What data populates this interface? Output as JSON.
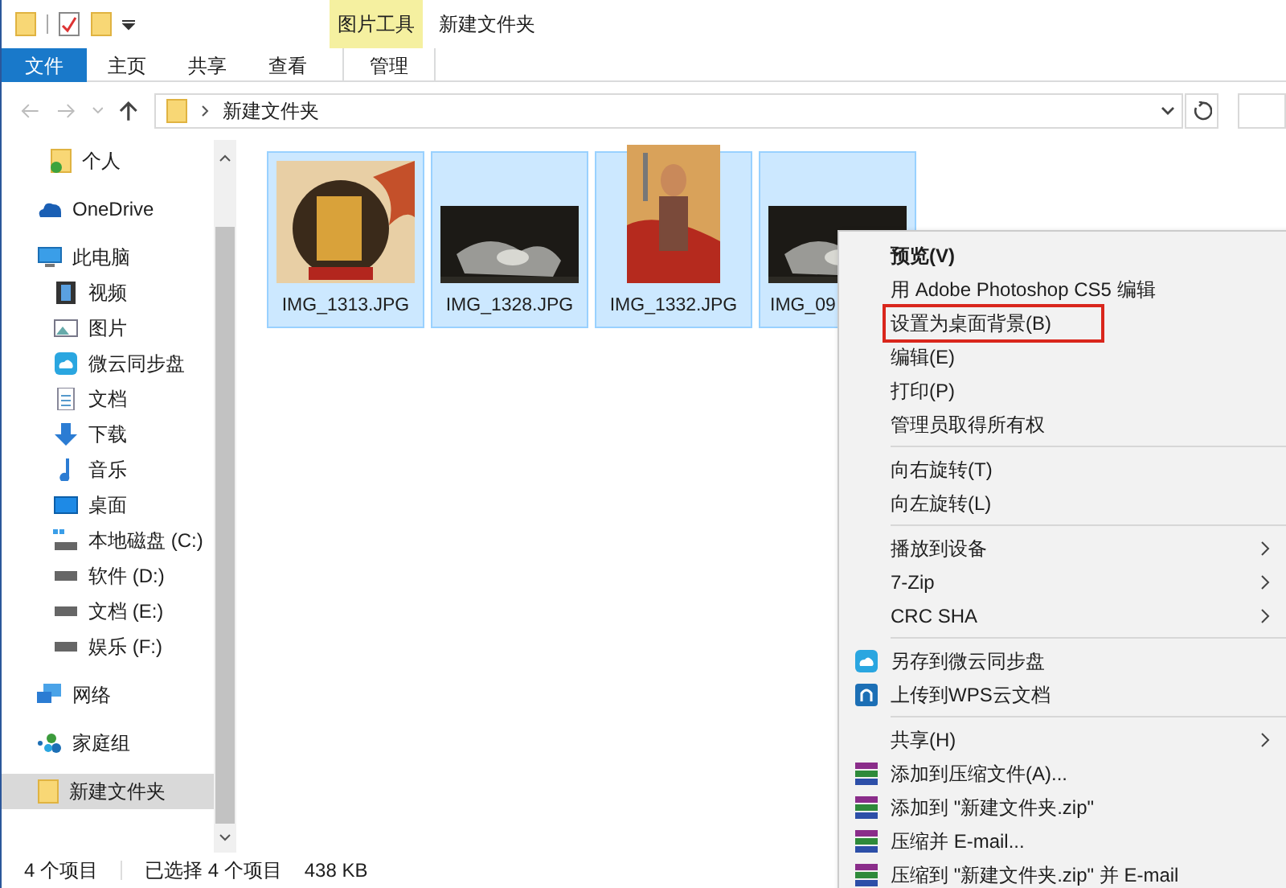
{
  "window": {
    "title": "新建文件夹"
  },
  "ribbon": {
    "context_group": "图片工具",
    "tabs": [
      {
        "label": "文件",
        "kind": "file",
        "selected": false
      },
      {
        "label": "主页",
        "kind": "tab",
        "selected": false
      },
      {
        "label": "共享",
        "kind": "tab",
        "selected": false
      },
      {
        "label": "查看",
        "kind": "tab",
        "selected": false
      },
      {
        "label": "管理",
        "kind": "context",
        "selected": false
      }
    ]
  },
  "address_bar": {
    "path": "新建文件夹"
  },
  "nav": {
    "quick_access_children": [
      {
        "label": "个人",
        "kind": "folder-check",
        "selected": false
      }
    ],
    "items": [
      {
        "label": "OneDrive",
        "kind": "cloud",
        "selected": false
      },
      {
        "label": "此电脑",
        "kind": "pc",
        "selected": false,
        "children": [
          {
            "label": "视频",
            "kind": "video",
            "selected": false
          },
          {
            "label": "图片",
            "kind": "picture",
            "selected": false
          },
          {
            "label": "微云同步盘",
            "kind": "weiyun",
            "selected": false
          },
          {
            "label": "文档",
            "kind": "document",
            "selected": false
          },
          {
            "label": "下载",
            "kind": "download",
            "selected": false
          },
          {
            "label": "音乐",
            "kind": "music",
            "selected": false
          },
          {
            "label": "桌面",
            "kind": "desktop",
            "selected": false
          },
          {
            "label": "本地磁盘 (C:)",
            "kind": "system-drive",
            "selected": false
          },
          {
            "label": "软件 (D:)",
            "kind": "drive",
            "selected": false
          },
          {
            "label": "文档 (E:)",
            "kind": "drive",
            "selected": false
          },
          {
            "label": "娱乐 (F:)",
            "kind": "drive",
            "selected": false
          }
        ]
      },
      {
        "label": "网络",
        "kind": "network",
        "selected": false
      },
      {
        "label": "家庭组",
        "kind": "homegroup",
        "selected": false
      },
      {
        "label": "新建文件夹",
        "kind": "folder",
        "selected": true
      }
    ]
  },
  "files": [
    {
      "name": "IMG_1313.JPG",
      "kind": "square",
      "selected": true
    },
    {
      "name": "IMG_1328.JPG",
      "kind": "wide",
      "selected": true
    },
    {
      "name": "IMG_1332.JPG",
      "kind": "tall",
      "selected": true
    },
    {
      "name": "IMG_09",
      "kind": "wide",
      "selected": true
    }
  ],
  "context_menu": [
    {
      "label": "预览(V)",
      "default": true,
      "submenu": false,
      "highlighted": false,
      "separator_before": false
    },
    {
      "label": "用 Adobe Photoshop CS5 编辑",
      "default": false,
      "submenu": false,
      "highlighted": false,
      "separator_before": false
    },
    {
      "label": "设置为桌面背景(B)",
      "default": false,
      "submenu": false,
      "highlighted": true,
      "separator_before": false
    },
    {
      "label": "编辑(E)",
      "default": false,
      "submenu": false,
      "highlighted": false,
      "separator_before": false
    },
    {
      "label": "打印(P)",
      "default": false,
      "submenu": false,
      "highlighted": false,
      "separator_before": false
    },
    {
      "label": "管理员取得所有权",
      "default": false,
      "submenu": false,
      "highlighted": false,
      "separator_before": false
    },
    {
      "label": "向右旋转(T)",
      "default": false,
      "submenu": false,
      "highlighted": false,
      "separator_before": true
    },
    {
      "label": "向左旋转(L)",
      "default": false,
      "submenu": false,
      "highlighted": false,
      "separator_before": false
    },
    {
      "label": "播放到设备",
      "default": false,
      "submenu": true,
      "highlighted": false,
      "separator_before": true
    },
    {
      "label": "7-Zip",
      "default": false,
      "submenu": true,
      "highlighted": false,
      "separator_before": false
    },
    {
      "label": "CRC SHA",
      "default": false,
      "submenu": true,
      "highlighted": false,
      "separator_before": false
    },
    {
      "label": "另存到微云同步盘",
      "kind": "weiyun",
      "default": false,
      "submenu": false,
      "highlighted": false,
      "separator_before": true
    },
    {
      "label": "上传到WPS云文档",
      "kind": "wps",
      "default": false,
      "submenu": false,
      "highlighted": false,
      "separator_before": false
    },
    {
      "label": "共享(H)",
      "default": false,
      "submenu": true,
      "highlighted": false,
      "separator_before": true
    },
    {
      "label": "添加到压缩文件(A)...",
      "kind": "archive",
      "default": false,
      "submenu": false,
      "highlighted": false,
      "separator_before": false
    },
    {
      "label": "添加到 \"新建文件夹.zip\"",
      "kind": "archive",
      "default": false,
      "submenu": false,
      "highlighted": false,
      "separator_before": false
    },
    {
      "label": "压缩并 E-mail...",
      "kind": "archive",
      "default": false,
      "submenu": false,
      "highlighted": false,
      "separator_before": false
    },
    {
      "label": "压缩到 \"新建文件夹.zip\" 并 E-mail",
      "kind": "archive",
      "default": false,
      "submenu": false,
      "highlighted": false,
      "separator_before": false
    }
  ],
  "status_bar": {
    "count": "4 个项目",
    "selection": "已选择 4 个项目",
    "size": "438 KB"
  }
}
